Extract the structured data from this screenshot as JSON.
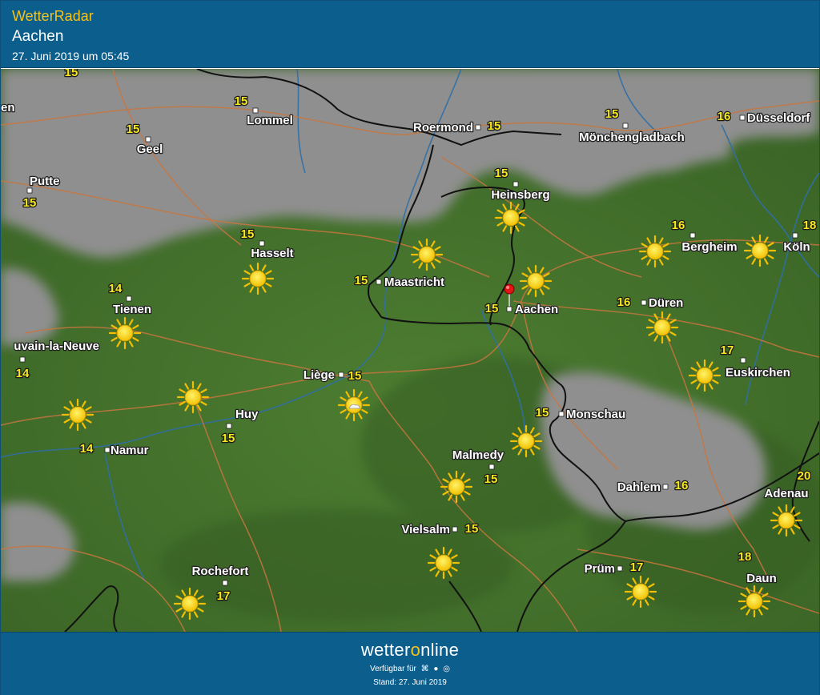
{
  "header": {
    "app_name": "WetterRadar",
    "location": "Aachen",
    "datetime": "27. Juni 2019 um 05:45"
  },
  "map": {
    "colors": {
      "land": "#44742d",
      "cloud": "#8c8c8c",
      "border": "#111111",
      "road": "#c8763f",
      "river": "#2f6fa6",
      "temp_text": "#f6e81c"
    },
    "selected_location": "Aachen",
    "places": [
      {
        "name": "Lommel",
        "temp": "15"
      },
      {
        "name": "Roermond",
        "temp": "15"
      },
      {
        "name": "Mönchengladbach",
        "temp": "15"
      },
      {
        "name": "Düsseldorf",
        "temp": "16"
      },
      {
        "name": "Geel",
        "temp": "15"
      },
      {
        "name": "Putte",
        "temp": "15"
      },
      {
        "name": "Heinsberg",
        "temp": "15"
      },
      {
        "name": "Bergheim",
        "temp": "16"
      },
      {
        "name": "Köln",
        "temp": "18"
      },
      {
        "name": "Hasselt",
        "temp": "15"
      },
      {
        "name": "Maastricht",
        "temp": "15"
      },
      {
        "name": "Aachen",
        "temp": "15"
      },
      {
        "name": "Tienen",
        "temp": "14"
      },
      {
        "name": "Düren",
        "temp": "16"
      },
      {
        "name": "uvain-la-Neuve",
        "temp": "14"
      },
      {
        "name": "Euskirchen",
        "temp": "17"
      },
      {
        "name": "Liège",
        "temp": "15"
      },
      {
        "name": "Huy",
        "temp": "15"
      },
      {
        "name": "Monschau",
        "temp": "15"
      },
      {
        "name": "Namur",
        "temp": "14"
      },
      {
        "name": "Malmedy",
        "temp": "15"
      },
      {
        "name": "Dahlem",
        "temp": "16"
      },
      {
        "name": "Adenau",
        "temp": "20"
      },
      {
        "name": "Vielsalm",
        "temp": "15"
      },
      {
        "name": "Rochefort",
        "temp": "17"
      },
      {
        "name": "Prüm",
        "temp": "17"
      },
      {
        "name": "Daun",
        "temp": "18"
      },
      {
        "name": "en",
        "temp": ""
      }
    ],
    "extra_temps": [
      "15"
    ],
    "weather_icons": [
      "sun",
      "sun-with-cloud"
    ]
  },
  "footer": {
    "brand_prefix": "wetter",
    "brand_o": "o",
    "brand_suffix": "nline",
    "available": "Verfügbar für",
    "platform_icons": [
      "android-icon",
      "apple-icon",
      "web-icon"
    ],
    "stand": "Stand: 27. Juni 2019"
  }
}
